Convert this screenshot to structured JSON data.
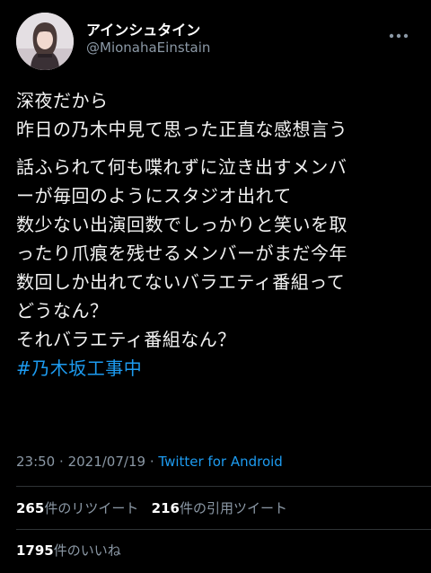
{
  "author": {
    "display_name": "アインシュタイン",
    "handle": "@MionahaEinstain"
  },
  "tweet": {
    "lines": [
      "深夜だから",
      "昨日の乃木中見て思った正直な感想言う",
      "話ふられて何も喋れずに泣き出すメンバ",
      "ーが毎回のようにスタジオ出れて",
      "数少ない出演回数でしっかりと笑いを取",
      "ったり爪痕を残せるメンバーがまだ今年",
      "数回しか出れてないバラエティ番組って",
      "どうなん？",
      "それバラエティ番組なん？"
    ],
    "hashtag": "#乃木坂工事中"
  },
  "meta": {
    "time": "23:50",
    "separator1": "·",
    "date": "2021/07/19",
    "separator2": "·",
    "source": "Twitter for Android"
  },
  "stats": {
    "retweets": {
      "count": "265",
      "label": "件のリツイート"
    },
    "quotes": {
      "count": "216",
      "label": "件の引用ツイート"
    },
    "likes": {
      "count": "1795",
      "label": "件のいいね"
    }
  },
  "icons": {
    "more": "more-dots-icon",
    "avatar": "profile-photo"
  },
  "colors": {
    "background": "#000000",
    "text": "#f2f2f2",
    "secondary": "#8b98a5",
    "link": "#1d9bf0",
    "divider": "#2f3336"
  }
}
